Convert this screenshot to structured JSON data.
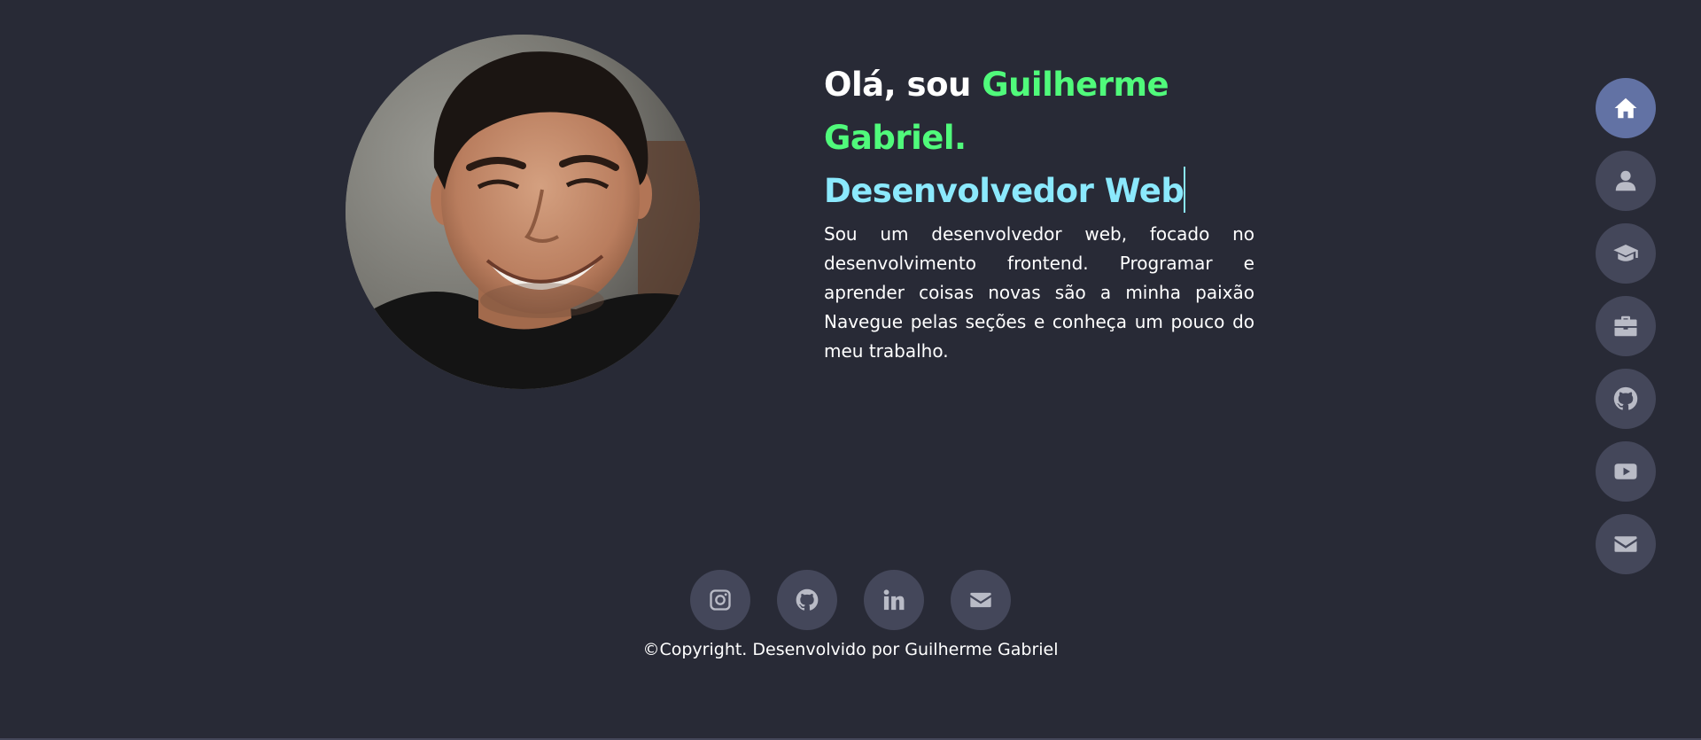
{
  "hero": {
    "greeting_prefix": "Olá, sou",
    "name": "Guilherme Gabriel.",
    "role": "Desenvolvedor Web",
    "bio": "Sou um desenvolvedor web, focado no desenvolvimento frontend. Programar e aprender coisas novas são a minha paixão Navegue pelas seções e conheça um pouco do meu trabalho."
  },
  "side_nav": {
    "items": [
      {
        "icon": "home-icon",
        "active": true
      },
      {
        "icon": "user-icon",
        "active": false
      },
      {
        "icon": "graduation-cap-icon",
        "active": false
      },
      {
        "icon": "briefcase-icon",
        "active": false
      },
      {
        "icon": "github-icon",
        "active": false
      },
      {
        "icon": "youtube-icon",
        "active": false
      },
      {
        "icon": "envelope-icon",
        "active": false
      }
    ]
  },
  "footer": {
    "socials": [
      {
        "icon": "instagram-icon"
      },
      {
        "icon": "github-icon"
      },
      {
        "icon": "linkedin-icon"
      },
      {
        "icon": "envelope-icon"
      }
    ],
    "copyright": "©Copyright. Desenvolvido por Guilherme Gabriel"
  },
  "colors": {
    "background": "#282a36",
    "accent_green": "#50fa7b",
    "accent_cyan": "#8be9fd",
    "button_bg": "#44475a",
    "button_active": "#6272a4"
  }
}
